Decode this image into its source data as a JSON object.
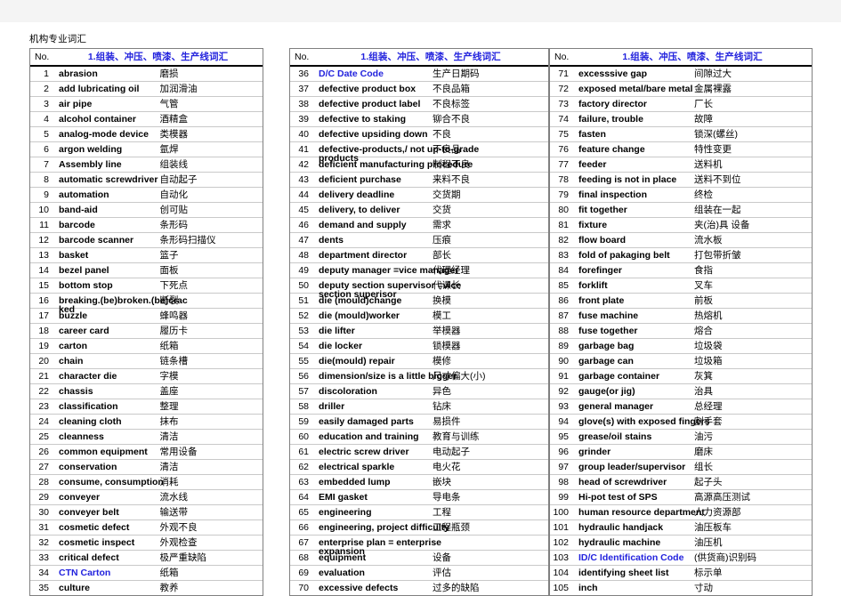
{
  "doc_title": "机构专业词汇",
  "columns": {
    "no_header": "No.",
    "title_header": "1.组装、冲压、喷漆、生产线词汇"
  },
  "blocks": [
    {
      "id": "block-1",
      "rows": [
        {
          "no": "1",
          "en": "abrasion",
          "zh": "磨损"
        },
        {
          "no": "2",
          "en": "add lubricating oil",
          "zh": "加润滑油"
        },
        {
          "no": "3",
          "en": "air pipe",
          "zh": "气管"
        },
        {
          "no": "4",
          "en": "alcohol container",
          "zh": "酒精盒"
        },
        {
          "no": "5",
          "en": "analog-mode device",
          "zh": "类模器"
        },
        {
          "no": "6",
          "en": "argon welding",
          "zh": "氩焊"
        },
        {
          "no": "7",
          "en": "Assembly line",
          "zh": "组装线"
        },
        {
          "no": "8",
          "en": "automatic screwdriver",
          "zh": "自动起子"
        },
        {
          "no": "9",
          "en": "automation",
          "zh": "自动化"
        },
        {
          "no": "10",
          "en": "band-aid",
          "zh": "创可贴"
        },
        {
          "no": "11",
          "en": "barcode",
          "zh": "条形码"
        },
        {
          "no": "12",
          "en": "barcode scanner",
          "zh": "条形码扫描仪"
        },
        {
          "no": "13",
          "en": "basket",
          "zh": "篮子"
        },
        {
          "no": "14",
          "en": "bezel panel",
          "zh": "面板"
        },
        {
          "no": "15",
          "en": "bottom stop",
          "zh": "下死点"
        },
        {
          "no": "16",
          "en": "breaking.(be)broken.(be)crac",
          "en_overflow": "ked",
          "zh": "断裂"
        },
        {
          "no": "17",
          "en": "buzzle",
          "zh": "蜂鸣器"
        },
        {
          "no": "18",
          "en": "career card",
          "zh": "履历卡"
        },
        {
          "no": "19",
          "en": "carton",
          "zh": "纸箱"
        },
        {
          "no": "20",
          "en": "chain",
          "zh": "链条槽"
        },
        {
          "no": "21",
          "en": "character die",
          "zh": "字模"
        },
        {
          "no": "22",
          "en": "chassis",
          "zh": "盖座"
        },
        {
          "no": "23",
          "en": "classification",
          "zh": "整理"
        },
        {
          "no": "24",
          "en": "cleaning cloth",
          "zh": "抹布"
        },
        {
          "no": "25",
          "en": "cleanness",
          "zh": "清洁"
        },
        {
          "no": "26",
          "en": "common equipment",
          "zh": "常用设备"
        },
        {
          "no": "27",
          "en": "conservation",
          "zh": "清洁"
        },
        {
          "no": "28",
          "en": "consume, consumption",
          "zh": "消耗"
        },
        {
          "no": "29",
          "en": "conveyer",
          "zh": "流水线"
        },
        {
          "no": "30",
          "en": "conveyer belt",
          "zh": "输送带"
        },
        {
          "no": "31",
          "en": "cosmetic defect",
          "zh": "外观不良"
        },
        {
          "no": "32",
          "en": "cosmetic inspect",
          "zh": "外观检查"
        },
        {
          "no": "33",
          "en": "critical defect",
          "zh": "极严重缺陷"
        },
        {
          "no": "34",
          "en": "CTN  Carton",
          "zh": "纸箱",
          "blue": true
        },
        {
          "no": "35",
          "en": "culture",
          "zh": "教养"
        }
      ]
    },
    {
      "id": "block-2",
      "rows": [
        {
          "no": "36",
          "en": "D/C   Date Code",
          "zh": "生产日期码",
          "blue": true
        },
        {
          "no": "37",
          "en": "defective product box",
          "zh": "不良品箱"
        },
        {
          "no": "38",
          "en": "defective product label",
          "zh": "不良标签"
        },
        {
          "no": "39",
          "en": "defective to staking",
          "zh": "铆合不良"
        },
        {
          "no": "40",
          "en": "defective upsiding down",
          "zh": "不良"
        },
        {
          "no": "41",
          "en": "defective-products,/ not up-to-grade",
          "en_overflow": "products",
          "zh": "不良品"
        },
        {
          "no": "42",
          "en": "deficient manufacturing procedure",
          "zh": "制程不良"
        },
        {
          "no": "43",
          "en": "deficient purchase",
          "zh": "来料不良"
        },
        {
          "no": "44",
          "en": "delivery deadline",
          "zh": "交货期"
        },
        {
          "no": "45",
          "en": "delivery, to deliver",
          "zh": "交货"
        },
        {
          "no": "46",
          "en": "demand and supply",
          "zh": "需求"
        },
        {
          "no": "47",
          "en": "dents",
          "zh": "压痕"
        },
        {
          "no": "48",
          "en": "department director",
          "zh": "部长"
        },
        {
          "no": "49",
          "en": "deputy manager  =vice manager",
          "zh": "代理经理"
        },
        {
          "no": "50",
          "en": "deputy section supervisor =vice",
          "en_overflow": "section superisor",
          "zh": "代课长"
        },
        {
          "no": "51",
          "en": "die (mould)change",
          "zh": "换模"
        },
        {
          "no": "52",
          "en": "die (mould)worker",
          "zh": "模工"
        },
        {
          "no": "53",
          "en": "die lifter",
          "zh": "举模器"
        },
        {
          "no": "54",
          "en": "die locker",
          "zh": "锁模器"
        },
        {
          "no": "55",
          "en": "die(mould) repair",
          "zh": "模修"
        },
        {
          "no": "56",
          "en": "dimension/size is a little bigger",
          "zh": "尺寸偏大(小)"
        },
        {
          "no": "57",
          "en": "discoloration",
          "zh": "异色"
        },
        {
          "no": "58",
          "en": "driller",
          "zh": "钻床"
        },
        {
          "no": "59",
          "en": "easily damaged parts",
          "zh": "易损件"
        },
        {
          "no": "60",
          "en": "education and training",
          "zh": "教育与训练"
        },
        {
          "no": "61",
          "en": "electric screw driver",
          "zh": "电动起子"
        },
        {
          "no": "62",
          "en": "electrical sparkle",
          "zh": "电火花"
        },
        {
          "no": "63",
          "en": "embedded lump",
          "zh": "嵌块"
        },
        {
          "no": "64",
          "en": "EMI gasket",
          "zh": "导电条"
        },
        {
          "no": "65",
          "en": "engineering",
          "zh": "工程"
        },
        {
          "no": "66",
          "en": "engineering, project difficulty",
          "zh": "工程瓶颈"
        },
        {
          "no": "67",
          "en": "enterprise plan = enterprise",
          "en_overflow": "expansion",
          "zh": ""
        },
        {
          "no": "68",
          "en": "equipment",
          "zh": "设备"
        },
        {
          "no": "69",
          "en": "evaluation",
          "zh": "评估"
        },
        {
          "no": "70",
          "en": "excessive defects",
          "zh": "过多的缺陷"
        }
      ]
    },
    {
      "id": "block-3",
      "rows": [
        {
          "no": "71",
          "en": "excesssive gap",
          "zh": "间隙过大"
        },
        {
          "no": "72",
          "en": "exposed metal/bare metal",
          "zh": "金属裸露"
        },
        {
          "no": "73",
          "en": "factory director",
          "zh": "厂长"
        },
        {
          "no": "74",
          "en": "failure, trouble",
          "zh": "故障"
        },
        {
          "no": "75",
          "en": "fasten",
          "zh": "锁深(螺丝)"
        },
        {
          "no": "76",
          "en": "feature change",
          "zh": "特性变更"
        },
        {
          "no": "77",
          "en": "feeder",
          "zh": "送料机"
        },
        {
          "no": "78",
          "en": "feeding is not in place",
          "zh": "送料不到位"
        },
        {
          "no": "79",
          "en": "final inspection",
          "zh": "终检"
        },
        {
          "no": "80",
          "en": "fit together",
          "zh": "组装在一起"
        },
        {
          "no": "81",
          "en": "fixture",
          "zh": "夹(治)具 设备"
        },
        {
          "no": "82",
          "en": "flow board",
          "zh": "流水板"
        },
        {
          "no": "83",
          "en": "fold of pakaging belt",
          "zh": "打包带折皱"
        },
        {
          "no": "84",
          "en": "forefinger",
          "zh": "食指"
        },
        {
          "no": "85",
          "en": "forklift",
          "zh": "叉车"
        },
        {
          "no": "86",
          "en": "front plate",
          "zh": "前板"
        },
        {
          "no": "87",
          "en": "fuse machine",
          "zh": "热熔机"
        },
        {
          "no": "88",
          "en": "fuse together",
          "zh": "熔合"
        },
        {
          "no": "89",
          "en": "garbage bag",
          "zh": "垃圾袋"
        },
        {
          "no": "90",
          "en": "garbage can",
          "zh": "垃圾箱"
        },
        {
          "no": "91",
          "en": "garbage container",
          "zh": "灰箕"
        },
        {
          "no": "92",
          "en": "gauge(or jig)",
          "zh": "治具"
        },
        {
          "no": "93",
          "en": "general manager",
          "zh": "总经理"
        },
        {
          "no": "94",
          "en": "glove(s) with exposed fingers",
          "zh": "割手套"
        },
        {
          "no": "95",
          "en": "grease/oil stains",
          "zh": "油污"
        },
        {
          "no": "96",
          "en": "grinder",
          "zh": "磨床"
        },
        {
          "no": "97",
          "en": "group leader/supervisor",
          "zh": "组长"
        },
        {
          "no": "98",
          "en": "head of screwdriver",
          "zh": "起子头"
        },
        {
          "no": "99",
          "en": "Hi-pot test of SPS",
          "zh": "高源高压测试"
        },
        {
          "no": "100",
          "en": "human resource department",
          "zh": "人力资源部"
        },
        {
          "no": "101",
          "en": "hydraulic handjack",
          "zh": "油压板车"
        },
        {
          "no": "102",
          "en": "hydraulic machine",
          "zh": "油压机"
        },
        {
          "no": "103",
          "en": "ID/C   Identification Code",
          "zh": "(供货商)识别码",
          "blue": true
        },
        {
          "no": "104",
          "en": "identifying sheet list",
          "zh": "标示单"
        },
        {
          "no": "105",
          "en": "inch",
          "zh": "寸动"
        }
      ]
    }
  ]
}
